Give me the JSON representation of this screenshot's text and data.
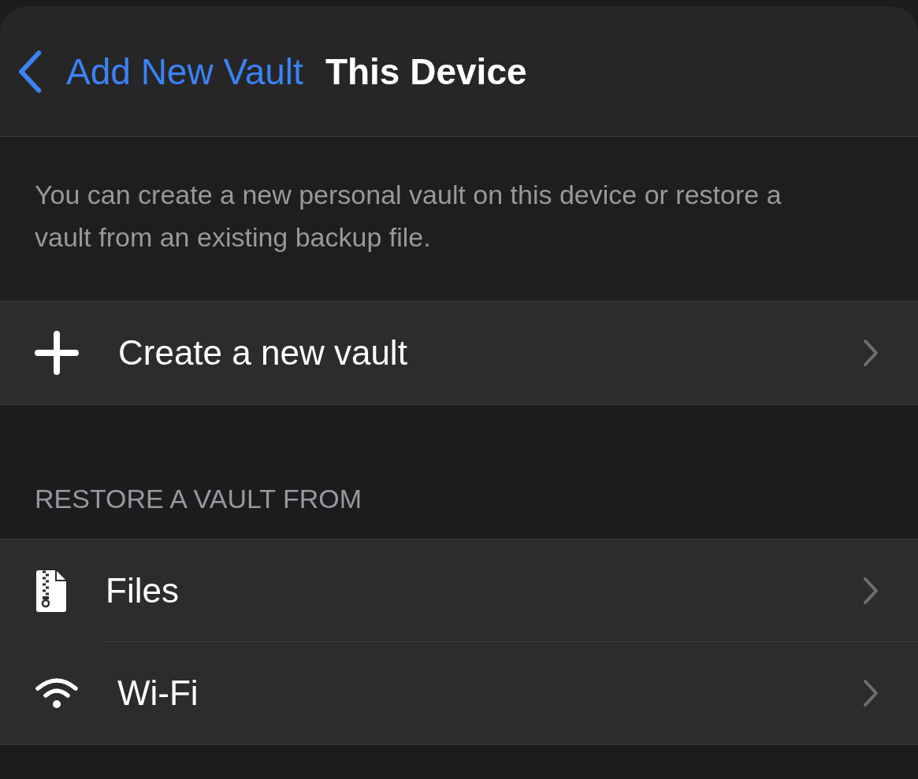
{
  "nav": {
    "back_label": "Add New Vault",
    "title": "This Device"
  },
  "description": "You can create a new personal vault on this device or restore a vault from an existing backup file.",
  "create_row": {
    "label": "Create a new vault"
  },
  "restore_section": {
    "header": "RESTORE A VAULT FROM",
    "items": [
      {
        "label": "Files"
      },
      {
        "label": "Wi-Fi"
      }
    ]
  }
}
